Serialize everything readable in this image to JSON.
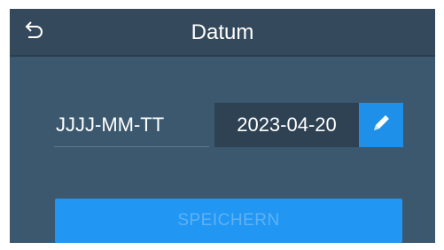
{
  "header": {
    "title": "Datum",
    "back_icon": "back-arrow-icon"
  },
  "date_row": {
    "format_label": "JJJJ-MM-TT",
    "value": "2023-04-20",
    "edit_icon": "pencil-icon"
  },
  "actions": {
    "save_label": "SPEICHERN",
    "save_enabled": false
  },
  "colors": {
    "background": "#3b586e",
    "header": "#34495c",
    "field": "#2e4253",
    "accent": "#2196f3"
  }
}
